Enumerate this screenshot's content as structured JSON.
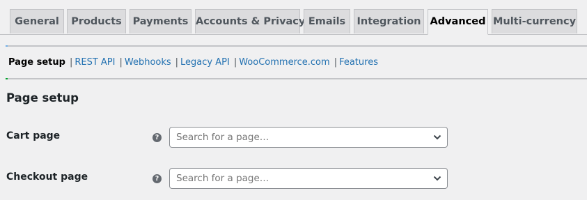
{
  "tabs": [
    {
      "label": "General",
      "active": false
    },
    {
      "label": "Products",
      "active": false
    },
    {
      "label": "Payments",
      "active": false
    },
    {
      "label": "Accounts & Privacy",
      "active": false
    },
    {
      "label": "Emails",
      "active": false
    },
    {
      "label": "Integration",
      "active": false
    },
    {
      "label": "Advanced",
      "active": true
    },
    {
      "label": "Multi-currency",
      "active": false
    }
  ],
  "subnav": {
    "current": "Page setup",
    "separator": "|",
    "links": [
      "REST API",
      "Webhooks",
      "Legacy API",
      "WooCommerce.com",
      "Features"
    ]
  },
  "section": {
    "title": "Page setup"
  },
  "fields": [
    {
      "label": "Cart page",
      "help_icon": "?",
      "placeholder": "Search for a page…"
    },
    {
      "label": "Checkout page",
      "help_icon": "?",
      "placeholder": "Search for a page…"
    }
  ],
  "colors": {
    "link": "#2271b1",
    "notice_accent_top": "#72aee6",
    "notice_accent_bottom": "#00a32a"
  }
}
